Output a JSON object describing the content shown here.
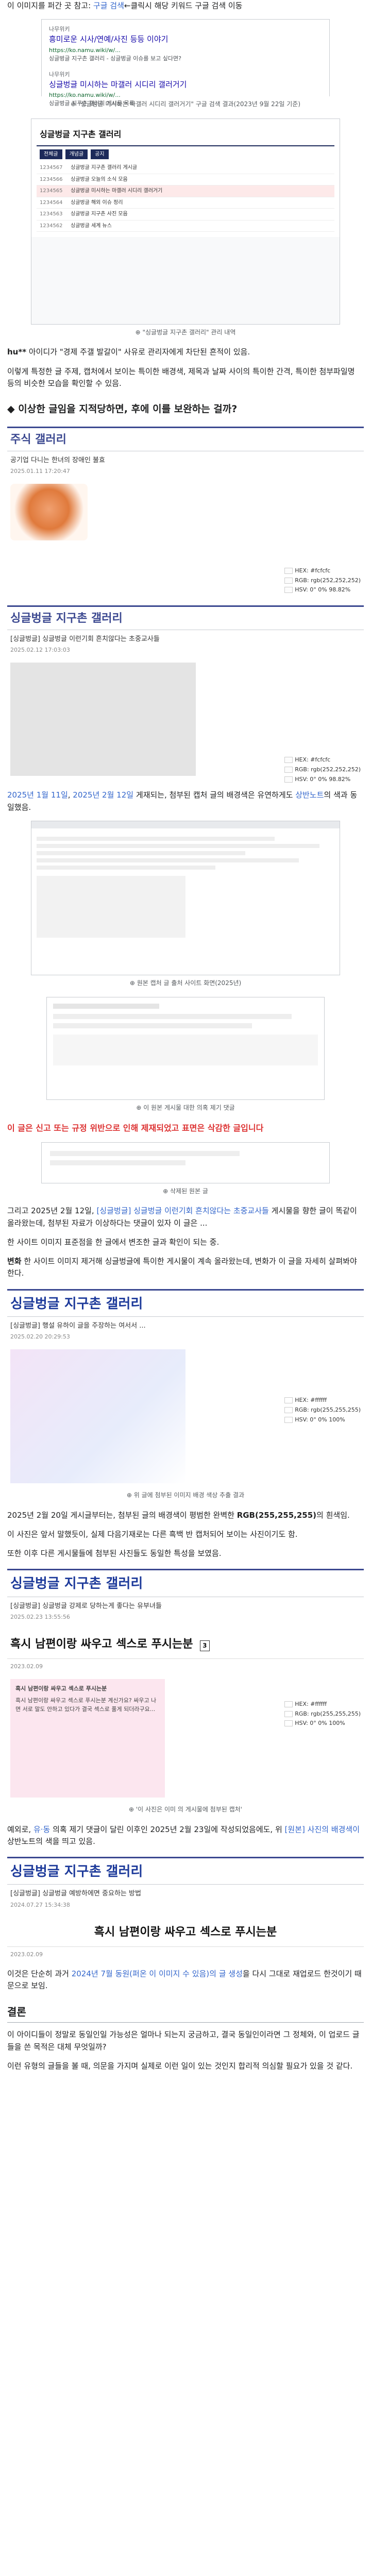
{
  "intro": {
    "line1_prefix": "이 이미지를 퍼간 곳 참고: ",
    "line1_link": "구글 검색",
    "line1_suffix": "←클릭시 해당 키워드 구글 검색 이동"
  },
  "search": {
    "r1_site": "나무위키",
    "r1_title": "흥미로운 시사/연예/사진 등등 이야기",
    "r1_url": "https://ko.namu.wiki/w/...",
    "r1_snippet": "싱글벙글 지구촌 갤러리 - 싱글벙글 이슈를 보고 싶다면?",
    "r2_site": "나무위키",
    "r2_title": "싱글벙글 미시하는 마갤러 시디리 갤러거기",
    "r2_url": "https://ko.namu.wiki/w/...",
    "r2_snippet": "싱글벙글 지구촌 갤러리 게시글 목록"
  },
  "caption1": "\"싱글벙글 미시하는 마갤러 시디리 갤러거기\" 구글 검색 결과(2023년 9월 22일 기준)",
  "board": {
    "title": "싱글벙글 지구촌 갤러리",
    "tabs": [
      "전체글",
      "개념글",
      "공지"
    ],
    "rows": [
      {
        "num": "1234567",
        "title": "싱글벙글 지구촌 갤러리 게시글"
      },
      {
        "num": "1234566",
        "title": "싱글벙글 오늘의 소식 모음"
      },
      {
        "num": "1234565",
        "title": "싱글벙글 미시하는 마갤러 시디리 갤러거기"
      },
      {
        "num": "1234564",
        "title": "싱글벙글 해외 이슈 정리"
      },
      {
        "num": "1234563",
        "title": "싱글벙글 지구촌 사진 모음"
      },
      {
        "num": "1234562",
        "title": "싱글벙글 세계 뉴스"
      }
    ]
  },
  "caption2": "\"싱글벙글 지구촌 갤러리\" 관리 내역",
  "para1": {
    "prefix": "hu**",
    "text": " 아이디가 \"경제 주갤 발갈이\" 사유로 관리자에게 차단된 흔적이 있음."
  },
  "para2": "이렇게 특정한 글 주제, 캡처에서 보이는 특이한 배경색, 제목과 날짜 사이의 특이한 간격, 특이한 첨부파일명 등의 비슷한 모습을 확인할 수 있음.",
  "bullet1": "이상한 글임을 지적당하면, 후에 이를 보완하는 걸까?",
  "gallery1": {
    "header": "주식 갤러리",
    "post_title": "공기업 다니는 한녀의 장애인 불효",
    "post_meta": "2025.01.11 17:20:47",
    "hex": "HEX: #fcfcfc",
    "rgb": "RGB: rgb(252,252,252)",
    "hsv": "HSV: 0° 0% 98.82%"
  },
  "gallery2": {
    "header": "싱글벙글 지구촌 갤러리",
    "post_title": "[싱글벙글] 싱글벙글 이런기회 흔치않다는 초중교사들",
    "post_meta": "2025.02.12 17:03:03",
    "hex": "HEX: #fcfcfc",
    "rgb": "RGB: rgb(252,252,252)",
    "hsv": "HSV: 0° 0% 98.82%"
  },
  "para3": {
    "date1": "2025년 1월 11일",
    "mid": ", ",
    "date2": "2025년 2월 12일",
    "text": " 게재되는, 첨부된 캡처 글의 배경색은 유연하게도 ",
    "colorword": "상반노트",
    "tail": "의 색과 동일했음."
  },
  "caption3": "원본 캡처 글 출처 사이트 화면(2025년)",
  "caption4": "이 원본 게시물 대한 의혹 제기 댓글",
  "red_note": "이 글은 신고 또는 규정 위반으로 인해 제재되었고 표면은 삭감한 글입니다",
  "caption5": "삭제된 원본 글",
  "para4": {
    "prefix": "그리고 2025년 2월 12일, ",
    "link": "[싱글벙글] 싱글벙글 이런기회 흔치않다는 초중교사들",
    "text": " 게시물을 향한 글이 똑같이 올라왔는데, 첨부된 자료가 이상하다는 댓글이 있자 이 글은 ..."
  },
  "para5": "한 사이트 이미지 표준점을 한 글에서 변조한 글과 확인이 되는 중.",
  "para6_label": "변화",
  "para6": "한 사이트 이미지 제거해 싱글벙글에 특이한 게시물이 계속 올라왔는데, 변화가 이 글을 자세히 살펴봐야 한다.",
  "gallery3": {
    "header": "싱글벙글 지구촌 갤러리",
    "post_title": "[싱글벙글] 행설 유하이 글을 주장하는 여서서 ...",
    "post_meta": "2025.02.20 20:29:53",
    "hex": "HEX: #ffffff",
    "rgb": "RGB: rgb(255,255,255)",
    "hsv": "HSV: 0° 0% 100%"
  },
  "caption6": "위 글에 첨부된 이미지 배경 색상 추출 결과",
  "para7": {
    "prefix": "2025년 2월 20일 게시글부터는, 첨부된 글의 배경색이 평범한 완벽한 ",
    "bold": "RGB(255,255,255)",
    "tail": "의 흰색임."
  },
  "para8": "이 사진은 앞서 말했듯이, 실제 다음기재로는 다른 흑백 반 캡처되어 보이는 사진이기도 함.",
  "para9": "또한 이후 다른 게시물들에 첨부된 사진들도 동일한 특성을 보였음.",
  "gallery4": {
    "header": "싱글벙글 지구촌 갤러리",
    "post_title": "[싱글벙글] 싱글벙글 강제로 당하는게 좋다는 유부녀들",
    "post_meta": "2025.02.23 13:55:56",
    "big_title": "흑시 남편이랑 싸우고 섹스로 푸시는분",
    "big_date": "2023.02.09",
    "inner_title": "흑시 남편이랑 싸우고 섹스로 푸시는분",
    "hex": "HEX: #ffffff",
    "rgb": "RGB: rgb(255,255,255)",
    "hsv": "HSV: 0° 0% 100%",
    "body": "흑시 남편이랑 싸우고 섹스로 푸시는분 계신가요? 싸우고 나면 서로 말도 안하고 있다가 결국 섹스로 풀게 되더라구요..."
  },
  "caption7": "'이 사진은 이미 의 게시물에 첨부된 캡처'",
  "para10": {
    "prefix": "예외로, ",
    "linkword": "유·동",
    "text": " 의혹 제기 댓글이 달린 이후인 2025년 2월 23일에 작성되었음에도, 위 ",
    "link2": "[원본] 사진의 배경색이",
    "tail": " 상반노트의 색을 띄고 있음."
  },
  "gallery5": {
    "header": "싱글벙글 지구촌 갤러리",
    "post_title": "[싱글벙글] 싱글벙글 예방하에면 중요하는 방법",
    "post_meta": "2024.07.27 15:34:38",
    "big_title": "흑시 남편이랑 싸우고 섹스로 푸시는분",
    "big_date": "2023.02.09"
  },
  "para11": {
    "prefix": "이것은 단순히 과거 ",
    "link": "2024년 7월 동원(퍼온 이 이미지 수 있음)의 글 생성",
    "tail": "을 다시 그대로 재업로드 한것이기 때문으로 보임."
  },
  "conclusion": {
    "heading": "결론",
    "p1": "이 아이디들이 정말로 동일인일 가능성은 얼마나 되는지 궁금하고, 결국 동일인이라면 그 정체와, 이 업로드 글들을 쓴 목적은 대체 무엇일까?",
    "p2": "이런 유형의 글들을 볼 때, 의문을 가지며 실제로 이런 일이 있는 것인지 합리적 의심할 필요가 있을 것 같다."
  }
}
